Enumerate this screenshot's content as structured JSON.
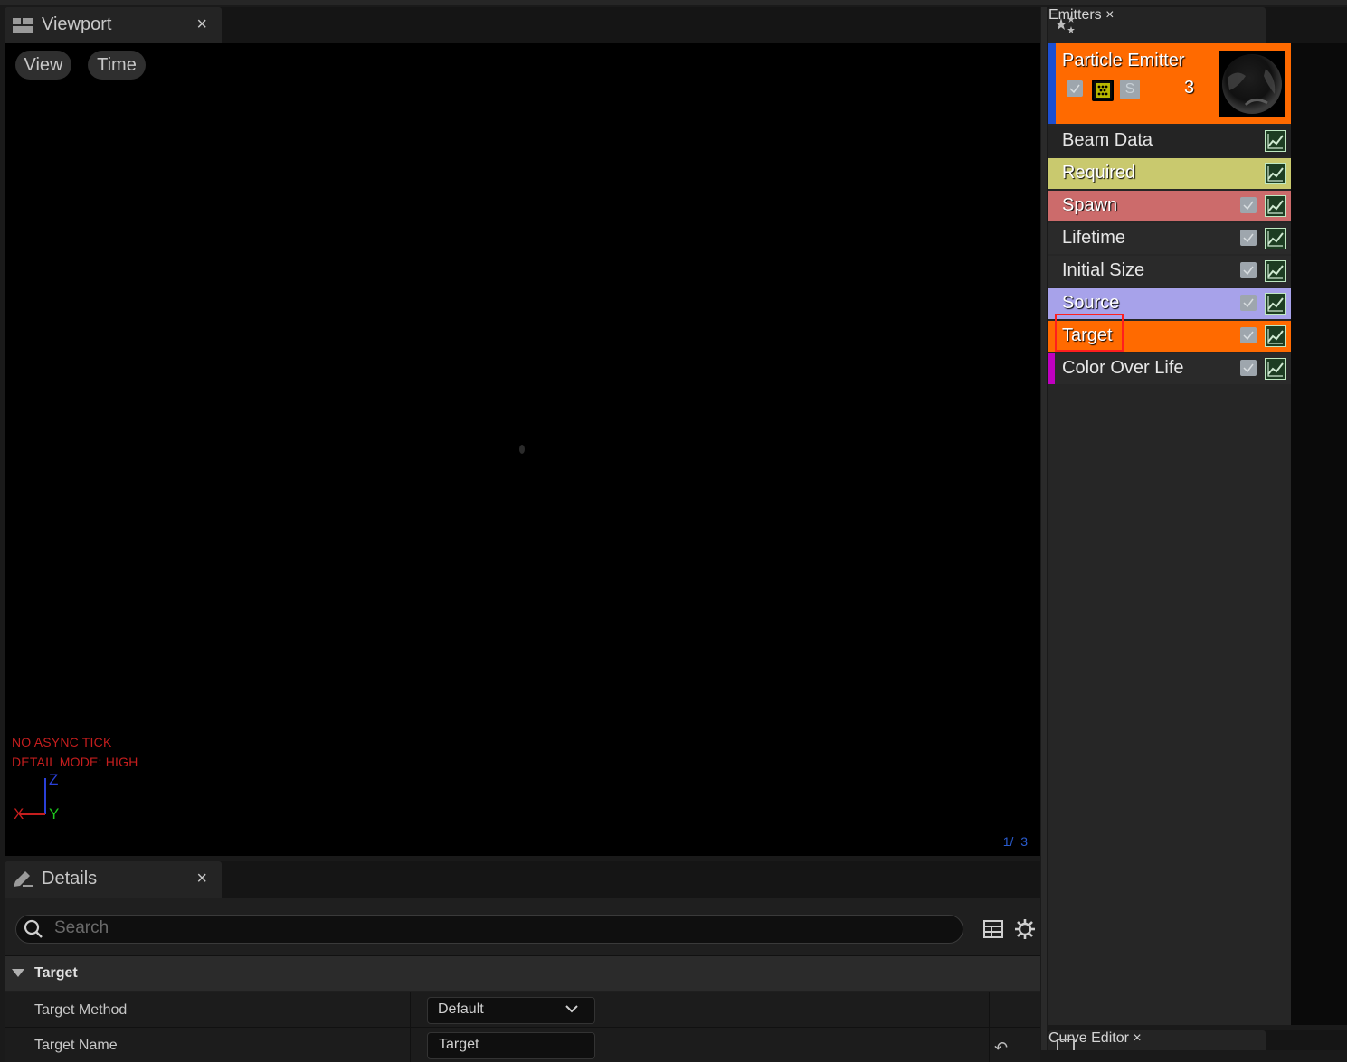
{
  "viewport": {
    "tab_title": "Viewport",
    "close_glyph": "×",
    "toolbar": {
      "view_label": "View",
      "time_label": "Time"
    },
    "stats": [
      "NO ASYNC TICK",
      "DETAIL MODE: HIGH"
    ],
    "axis": {
      "x": "X",
      "y": "Y",
      "z": "Z"
    },
    "counter": "1/  3"
  },
  "details": {
    "tab_title": "Details",
    "close_glyph": "×",
    "search_placeholder": "Search",
    "category": "Target",
    "properties": [
      {
        "name": "Target Method",
        "value": "Default"
      },
      {
        "name": "Target Name",
        "value": "Target"
      }
    ],
    "reset_glyph": "↶"
  },
  "emitters": {
    "tab_title": "Emitters",
    "close_glyph": "×",
    "emitter": {
      "name": "Particle Emitter",
      "count": "3",
      "solo_letter": "S"
    },
    "modules": [
      {
        "label": "Beam Data",
        "bg": "#242424",
        "text": "#e6e6e6",
        "checkbox": false,
        "accent": ""
      },
      {
        "label": "Required",
        "bg": "#c9c96e",
        "text": "#ffffff",
        "checkbox": false,
        "accent": ""
      },
      {
        "label": "Spawn",
        "bg": "#cc6b6b",
        "text": "#ffffff",
        "checkbox": true,
        "accent": ""
      },
      {
        "label": "Lifetime",
        "bg": "#2a2a2a",
        "text": "#e6e6e6",
        "checkbox": true,
        "accent": ""
      },
      {
        "label": "Initial Size",
        "bg": "#2a2a2a",
        "text": "#e6e6e6",
        "checkbox": true,
        "accent": ""
      },
      {
        "label": "Source",
        "bg": "#a7a2ea",
        "text": "#ffffff",
        "checkbox": true,
        "accent": ""
      },
      {
        "label": "Target",
        "bg": "#ff6a00",
        "text": "#ffffff",
        "checkbox": true,
        "accent": ""
      },
      {
        "label": "Color Over Life",
        "bg": "#2a2a2a",
        "text": "#e6e6e6",
        "checkbox": true,
        "accent": "#c000c0"
      }
    ]
  },
  "curve_editor": {
    "tab_title": "Curve Editor",
    "close_glyph": "×"
  }
}
